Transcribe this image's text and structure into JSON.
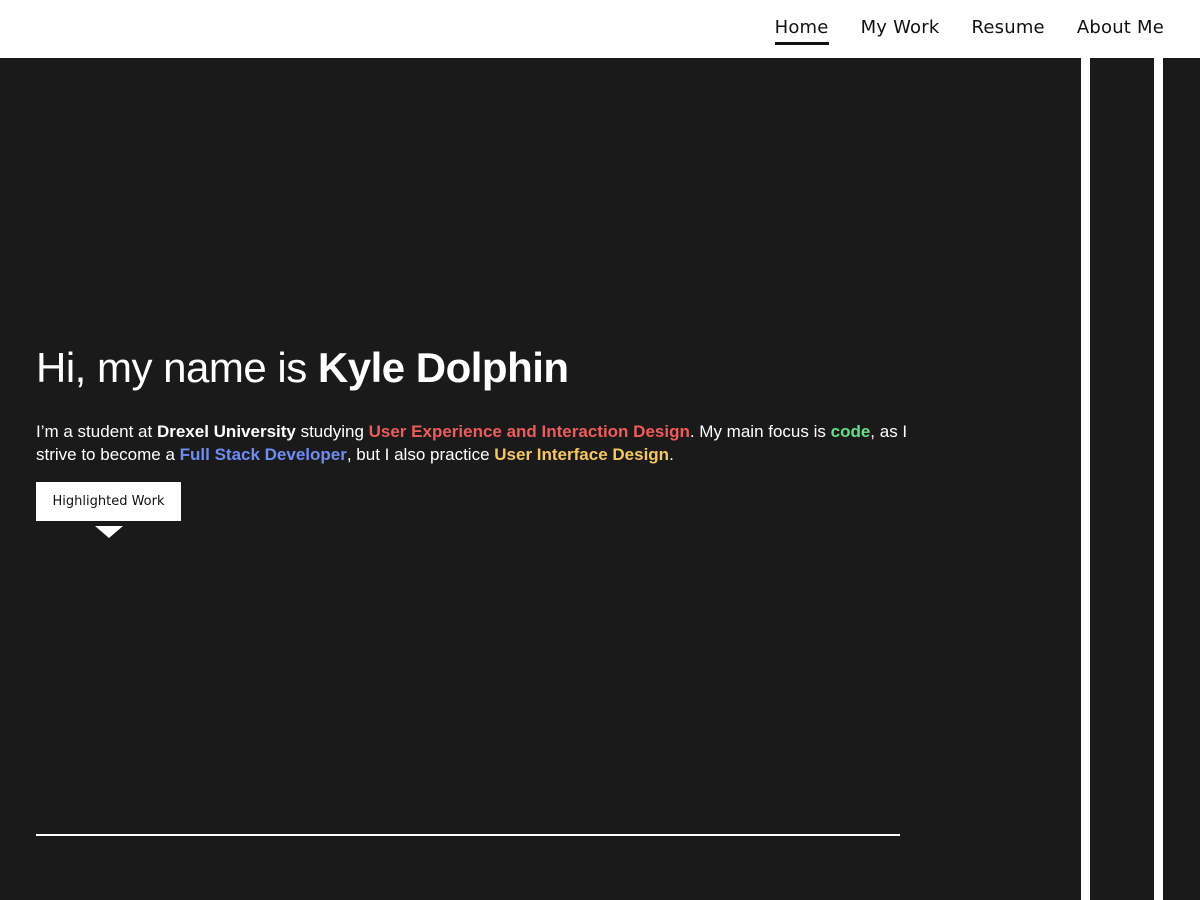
{
  "nav": {
    "items": [
      {
        "label": "Home",
        "active": true
      },
      {
        "label": "My Work",
        "active": false
      },
      {
        "label": "Resume",
        "active": false
      },
      {
        "label": "About Me",
        "active": false
      }
    ]
  },
  "hero": {
    "greeting": "Hi, my name is ",
    "name": "Kyle Dolphin",
    "intro": {
      "p1": "I’m a student at ",
      "university": "Drexel University",
      "p2": " studying ",
      "major": "User Experience and Interaction Design",
      "p3": ". My main focus is ",
      "focus": "code",
      "p4": ", as I strive to become a ",
      "goal": "Full Stack Developer",
      "p5": ", but I also practice ",
      "practice": "User Interface Design",
      "p6": "."
    },
    "button_label": "Highlighted Work"
  },
  "colors": {
    "background": "#1a1a1a",
    "accent_red": "#ef5b5b",
    "accent_green": "#5ee08a",
    "accent_blue": "#6f8cf5",
    "accent_yellow": "#f5c85b"
  }
}
